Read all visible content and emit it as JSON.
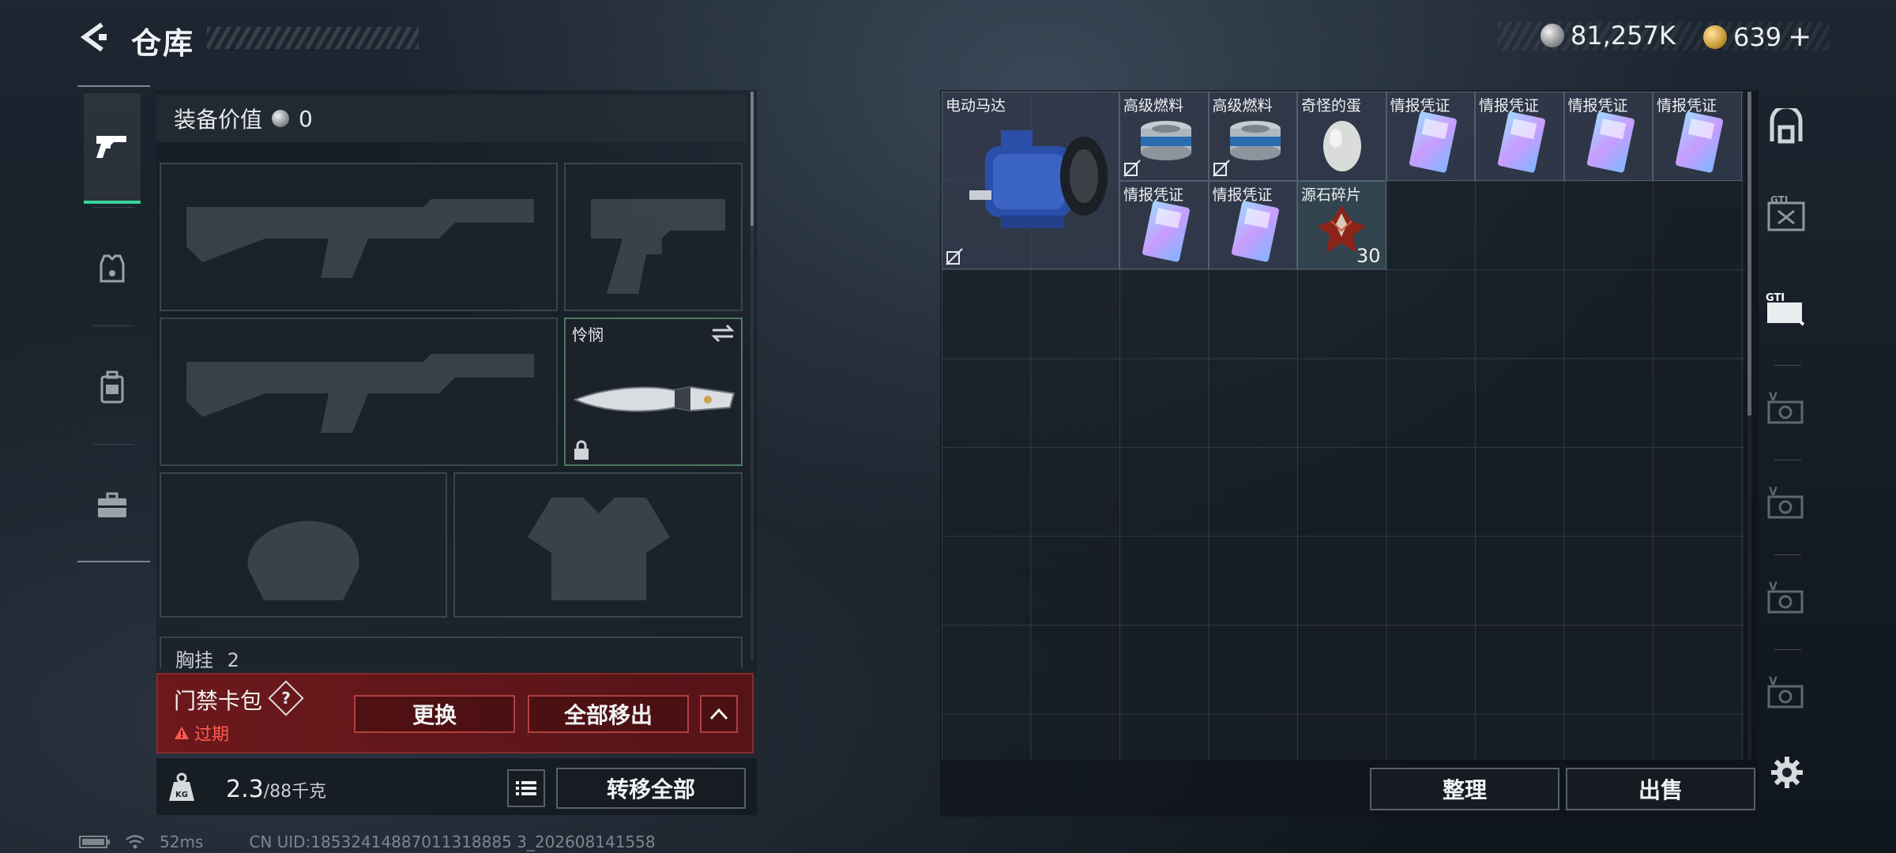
{
  "header": {
    "title": "仓库",
    "currency_silver": "81,257K",
    "currency_gold": "639",
    "currency_gold_plus": "+"
  },
  "left_nav": {
    "items": [
      "weapon",
      "armor",
      "backpack",
      "toolbox"
    ],
    "active": "weapon"
  },
  "equipment": {
    "value_label": "装备价值",
    "value": "0",
    "melee_name": "怜悯",
    "chest_label": "胸挂",
    "chest_count": "2"
  },
  "keycard": {
    "title": "门禁卡包",
    "help": "?",
    "status": "过期",
    "replace_label": "更换",
    "remove_all_label": "全部移出"
  },
  "weight": {
    "current": "2.3",
    "max": "/88千克",
    "transfer_all_label": "转移全部"
  },
  "status": {
    "ping": "52ms",
    "uid": "CN UID:18532414887011318885 3_202608141558"
  },
  "storage": {
    "items": [
      {
        "name": "电动马达",
        "qty": ""
      },
      {
        "name": "高级燃料",
        "qty": ""
      },
      {
        "name": "高级燃料",
        "qty": ""
      },
      {
        "name": "奇怪的蛋",
        "qty": ""
      },
      {
        "name": "情报凭证",
        "qty": ""
      },
      {
        "name": "情报凭证",
        "qty": ""
      },
      {
        "name": "情报凭证",
        "qty": ""
      },
      {
        "name": "情报凭证",
        "qty": ""
      },
      {
        "name": "情报凭证",
        "qty": ""
      },
      {
        "name": "情报凭证",
        "qty": ""
      },
      {
        "name": "源石碎片",
        "qty": "30"
      }
    ],
    "sort_label": "整理",
    "sell_label": "出售"
  },
  "colors": {
    "accent_green": "#38d39b",
    "keycard_red": "#7a1618",
    "expired_red": "#ff5a4e"
  }
}
